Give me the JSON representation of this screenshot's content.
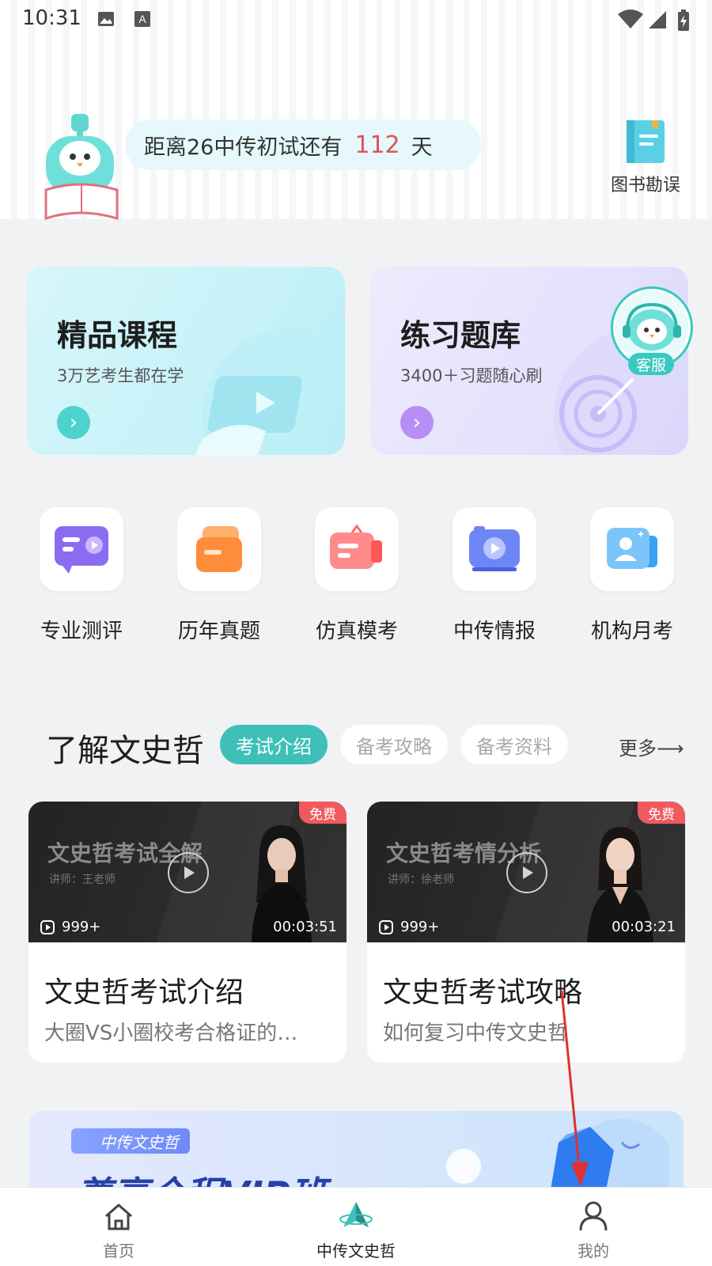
{
  "status": {
    "time": "10:31"
  },
  "header": {
    "countdown_prefix": "距离26中传初试还有",
    "countdown_days": "112",
    "countdown_suffix": "天",
    "book_errata": "图书勘误"
  },
  "cards": [
    {
      "title": "精品课程",
      "subtitle": "3万艺考生都在学"
    },
    {
      "title": "练习题库",
      "subtitle": "3400＋习题随心刷"
    }
  ],
  "customer_service": "客服",
  "quick_actions": [
    {
      "label": "专业测评",
      "icon": "evaluation-icon"
    },
    {
      "label": "历年真题",
      "icon": "past-papers-icon"
    },
    {
      "label": "仿真模考",
      "icon": "mock-exam-icon"
    },
    {
      "label": "中传情报",
      "icon": "news-icon"
    },
    {
      "label": "机构月考",
      "icon": "monthly-exam-icon"
    }
  ],
  "section": {
    "title": "了解文史哲",
    "tabs": [
      "考试介绍",
      "备考攻略",
      "备考资料"
    ],
    "more": "更多⟶"
  },
  "videos": [
    {
      "thumb_title": "文史哲考试全解",
      "teacher": "讲师：王老师",
      "badge": "免费",
      "views": "999+",
      "duration": "00:03:51",
      "title": "文史哲考试介绍",
      "desc": "大圈VS小圈校考合格证的…"
    },
    {
      "thumb_title": "文史哲考情分析",
      "teacher": "讲师：徐老师",
      "badge": "免费",
      "views": "999+",
      "duration": "00:03:21",
      "title": "文史哲考试攻略",
      "desc": "如何复习中传文史哲"
    }
  ],
  "banner": {
    "tag": "中传文史哲",
    "headline": "尊享全程VIP班"
  },
  "tabbar": [
    {
      "label": "首页",
      "icon": "home-icon"
    },
    {
      "label": "中传文史哲",
      "icon": "app-logo-icon",
      "active": true
    },
    {
      "label": "我的",
      "icon": "profile-icon"
    }
  ],
  "colors": {
    "accent": "#3ec0b8",
    "countdown_number": "#e0535a",
    "badge": "#f05a5f",
    "annotation": "#e03131"
  }
}
